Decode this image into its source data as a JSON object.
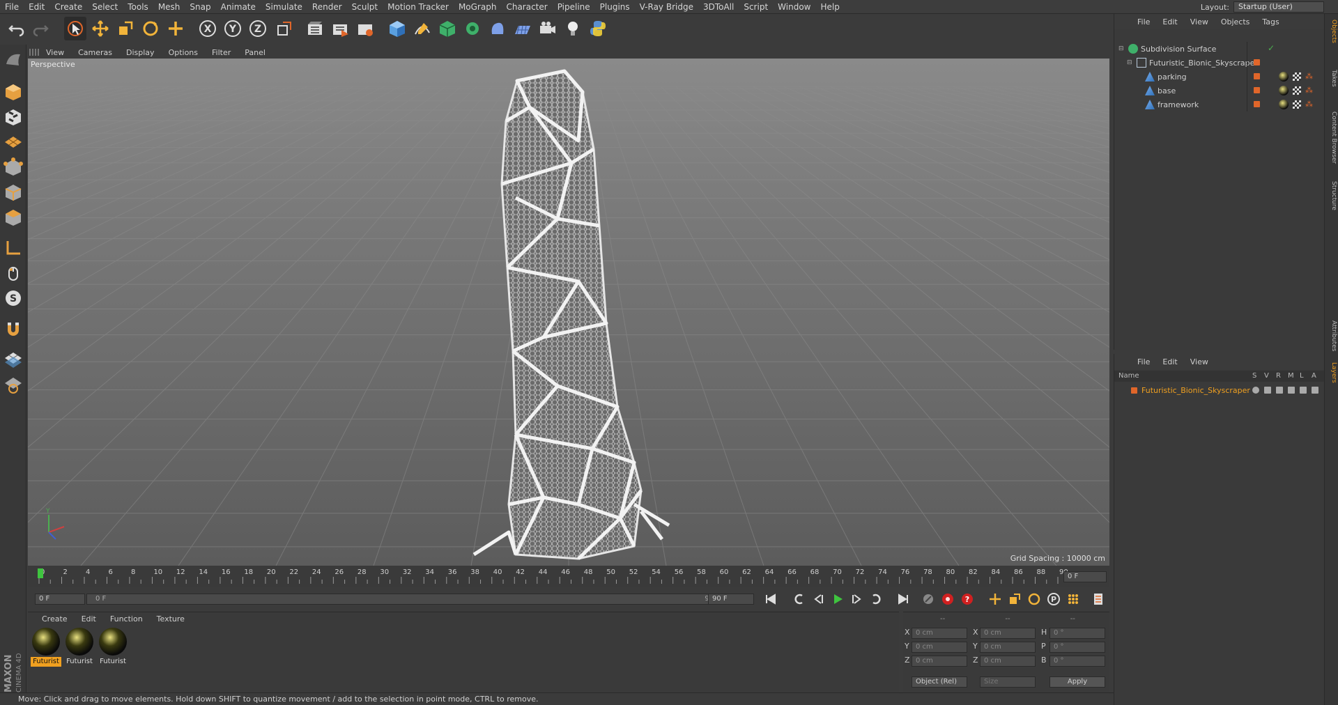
{
  "menubar": {
    "items": [
      "File",
      "Edit",
      "Create",
      "Select",
      "Tools",
      "Mesh",
      "Snap",
      "Animate",
      "Simulate",
      "Render",
      "Sculpt",
      "Motion Tracker",
      "MoGraph",
      "Character",
      "Pipeline",
      "Plugins",
      "V-Ray Bridge",
      "3DToAll",
      "Script",
      "Window",
      "Help"
    ],
    "layout_label": "Layout:",
    "layout_value": "Startup (User)"
  },
  "viewport": {
    "menu": [
      "View",
      "Cameras",
      "Display",
      "Options",
      "Filter",
      "Panel"
    ],
    "label": "Perspective",
    "grid_spacing": "Grid Spacing : 10000 cm"
  },
  "timeline": {
    "ticks": [
      "0",
      "2",
      "4",
      "6",
      "8",
      "10",
      "12",
      "14",
      "16",
      "18",
      "20",
      "22",
      "24",
      "26",
      "28",
      "30",
      "32",
      "34",
      "36",
      "38",
      "40",
      "42",
      "44",
      "46",
      "48",
      "50",
      "52",
      "54",
      "56",
      "58",
      "60",
      "62",
      "64",
      "66",
      "68",
      "70",
      "72",
      "74",
      "76",
      "78",
      "80",
      "82",
      "84",
      "86",
      "88",
      "90"
    ],
    "current_frame": "0 F",
    "start_field": "0 F",
    "range_start": "0 F",
    "range_end": "90 F",
    "end_field": "90 F"
  },
  "materials": {
    "menu": [
      "Create",
      "Edit",
      "Function",
      "Texture"
    ],
    "items": [
      {
        "label": "Futurist",
        "selected": true
      },
      {
        "label": "Futurist",
        "selected": false
      },
      {
        "label": "Futurist",
        "selected": false
      }
    ]
  },
  "coords": {
    "header": [
      "--",
      "--",
      "--"
    ],
    "rows": [
      {
        "a": "X",
        "av": "0 cm",
        "b": "X",
        "bv": "0 cm",
        "c": "H",
        "cv": "0 °"
      },
      {
        "a": "Y",
        "av": "0 cm",
        "b": "Y",
        "bv": "0 cm",
        "c": "P",
        "cv": "0 °"
      },
      {
        "a": "Z",
        "av": "0 cm",
        "b": "Z",
        "bv": "0 cm",
        "c": "B",
        "cv": "0 °"
      }
    ],
    "mode": "Object (Rel)",
    "size": "Size",
    "apply": "Apply"
  },
  "objects": {
    "menu": [
      "File",
      "Edit",
      "View",
      "Objects",
      "Tags"
    ],
    "tree": [
      {
        "name": "Subdivision Surface",
        "indent": 0
      },
      {
        "name": "Futuristic_Bionic_Skyscraper",
        "indent": 1
      },
      {
        "name": "parking",
        "indent": 2
      },
      {
        "name": "base",
        "indent": 2
      },
      {
        "name": "framework",
        "indent": 2
      }
    ]
  },
  "layers": {
    "menu": [
      "File",
      "Edit",
      "View"
    ],
    "columns": [
      "Name",
      "S",
      "V",
      "R",
      "M",
      "L",
      "A"
    ],
    "items": [
      {
        "name": "Futuristic_Bionic_Skyscraper"
      }
    ]
  },
  "right_tabs": [
    "Objects",
    "Takes",
    "Content Browser",
    "Structure",
    "Attributes",
    "Layers"
  ],
  "status": "Move: Click and drag to move elements. Hold down SHIFT to quantize movement / add to the selection in point mode, CTRL to remove.",
  "brand": "MAXON CINEMA 4D",
  "colors": {
    "accent": "#e0662a",
    "selected_label": "#f0a020",
    "play": "#3fc43f"
  }
}
